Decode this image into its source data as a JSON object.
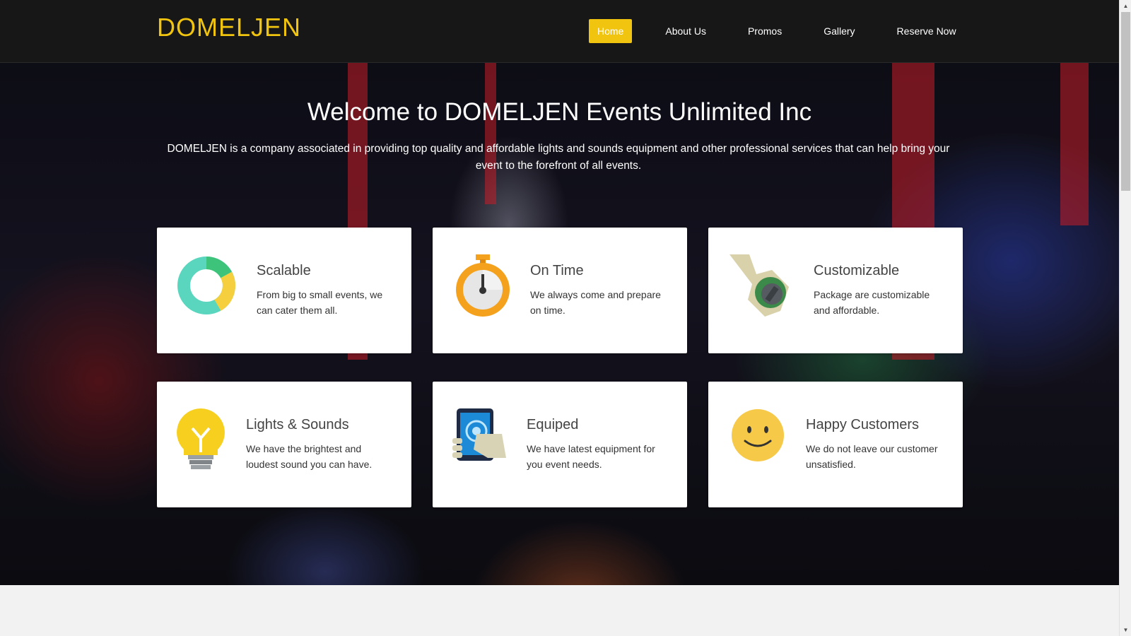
{
  "header": {
    "brand": "DOMELJEN",
    "nav": [
      {
        "label": "Home",
        "active": true
      },
      {
        "label": "About Us"
      },
      {
        "label": "Promos"
      },
      {
        "label": "Gallery"
      },
      {
        "label": "Reserve Now"
      }
    ]
  },
  "hero": {
    "title": "Welcome to DOMELJEN Events Unlimited Inc",
    "description": "DOMELJEN is a company associated in providing top quality and affordable lights and sounds equipment and other professional services that can help bring your event to the forefront of all events."
  },
  "features": [
    {
      "icon": "donut-chart-icon",
      "title": "Scalable",
      "text": "From big to small events, we can cater them all."
    },
    {
      "icon": "stopwatch-icon",
      "title": "On Time",
      "text": "We always come and prepare on time."
    },
    {
      "icon": "wrench-icon",
      "title": "Customizable",
      "text": "Package are customizable and affordable."
    },
    {
      "icon": "lightbulb-icon",
      "title": "Lights & Sounds",
      "text": "We have the brightest and loudest sound you can have."
    },
    {
      "icon": "tablet-touch-icon",
      "title": "Equiped",
      "text": "We have latest equipment for you event needs."
    },
    {
      "icon": "smiley-face-icon",
      "title": "Happy Customers",
      "text": "We do not leave our customer unsatisfied."
    }
  ],
  "colors": {
    "accent": "#f1c40f",
    "header_bg": "#171717"
  }
}
